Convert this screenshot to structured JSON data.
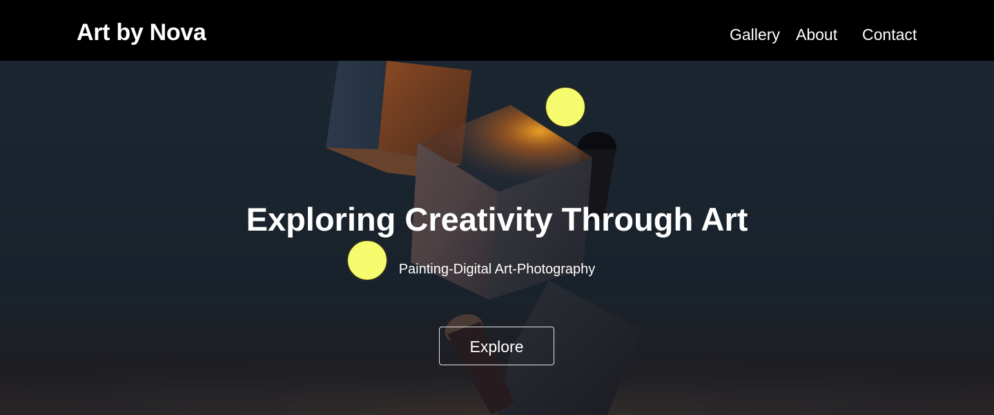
{
  "header": {
    "brand": "Art by Nova",
    "nav": [
      {
        "label": "Gallery"
      },
      {
        "label": "About"
      },
      {
        "label": "Contact"
      }
    ]
  },
  "hero": {
    "title": "Exploring Creativity Through Art",
    "subtitle": "Painting-Digital Art-Photography",
    "cta_label": "Explore"
  },
  "colors": {
    "header_bg": "#000000",
    "hero_bg": "#1b2631",
    "orb": "#f6fb6e",
    "text": "#ffffff"
  }
}
